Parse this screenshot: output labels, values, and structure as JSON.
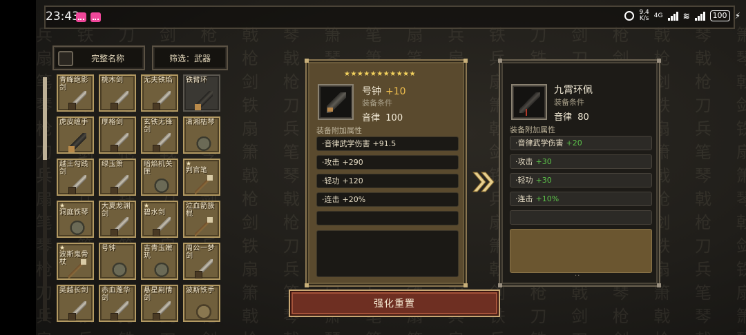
{
  "status": {
    "time": "23:43",
    "speed_top": "9.4",
    "speed_bottom": "K/s",
    "network": "4G",
    "battery": "100"
  },
  "filters": {
    "full_name_label": "完整名称",
    "filter_label": "筛选：武器"
  },
  "grid": {
    "items": [
      {
        "name": "青峰绝影剑",
        "star": false,
        "icon": "sword-icon",
        "dark": false
      },
      {
        "name": "桃木剑",
        "star": false,
        "icon": "sword-icon",
        "dark": false
      },
      {
        "name": "无夫铁焰",
        "star": false,
        "icon": "sword-icon",
        "dark": false
      },
      {
        "name": "铁臂环",
        "star": false,
        "icon": "bracer-icon",
        "dark": true
      },
      {
        "name": "虎皮缠手",
        "star": false,
        "icon": "bracer-icon",
        "dark": false
      },
      {
        "name": "厚格剑",
        "star": false,
        "icon": "sword-icon",
        "dark": false
      },
      {
        "name": "玄铁无锋剑",
        "star": false,
        "icon": "sword-icon",
        "dark": false
      },
      {
        "name": "潇湘枯琴",
        "star": false,
        "icon": "guqin-icon",
        "dark": false
      },
      {
        "name": "越王勾践剑",
        "star": false,
        "icon": "sword-icon",
        "dark": false
      },
      {
        "name": "绿玉箫",
        "star": false,
        "icon": "flute-icon",
        "dark": false
      },
      {
        "name": "暗焰机关匣",
        "star": false,
        "icon": "box-icon",
        "dark": false
      },
      {
        "name": "判官笔",
        "star": true,
        "icon": "brush-icon",
        "dark": false
      },
      {
        "name": "洞庭铁琴",
        "star": true,
        "icon": "guqin-icon",
        "dark": false
      },
      {
        "name": "大夏龙渊剑",
        "star": false,
        "icon": "sword-icon",
        "dark": false
      },
      {
        "name": "碧水剑",
        "star": true,
        "icon": "sword-icon",
        "dark": false
      },
      {
        "name": "泣血箭簇棍",
        "star": false,
        "icon": "staff-icon",
        "dark": false
      },
      {
        "name": "波斯鬼骨杖",
        "star": true,
        "icon": "staff-icon",
        "dark": false
      },
      {
        "name": "号钟",
        "star": false,
        "icon": "guqin-icon",
        "dark": false
      },
      {
        "name": "吉青玉嫩玑",
        "star": false,
        "icon": "box-icon",
        "dark": false
      },
      {
        "name": "周公一梦剑",
        "star": false,
        "icon": "sword-icon",
        "dark": false
      },
      {
        "name": "吴越长剑",
        "star": false,
        "icon": "sword-icon",
        "dark": false
      },
      {
        "name": "赤血蓬华剑",
        "star": false,
        "icon": "sword-icon",
        "dark": false
      },
      {
        "name": "悬星剧情剑",
        "star": false,
        "icon": "sword-icon",
        "dark": false
      },
      {
        "name": "波斯铁手",
        "star": false,
        "icon": "glove-icon",
        "dark": false
      }
    ]
  },
  "current_item": {
    "stars": "★★★★★★★★★★★",
    "name": "号钟",
    "plus": "+10",
    "requirement_label": "装备条件",
    "stat_label": "音律",
    "stat_value": "100",
    "bonus_label": "装备附加属性",
    "attrs": [
      {
        "label": "·音律武学伤害",
        "value": "+91.5"
      },
      {
        "label": "·攻击",
        "value": "+290"
      },
      {
        "label": "·轻功",
        "value": "+120"
      },
      {
        "label": "·连击",
        "value": "+20%"
      }
    ]
  },
  "target_item": {
    "name": "九霄环佩",
    "requirement_label": "装备条件",
    "stat_label": "音律",
    "stat_value": "80",
    "bonus_label": "装备附加属性",
    "attrs": [
      {
        "label": "·音律武学伤害",
        "value": "+20"
      },
      {
        "label": "·攻击",
        "value": "+30"
      },
      {
        "label": "·轻功",
        "value": "+30"
      },
      {
        "label": "·连击",
        "value": "+10%"
      }
    ],
    "scroll_hint": "··"
  },
  "actions": {
    "reset_label": "强化重置"
  },
  "colors": {
    "gold_panel": "#5a4a2e",
    "reset_button": "#6e2f22",
    "positive_value": "#5cc24a",
    "plus_level": "#f2c14e"
  }
}
